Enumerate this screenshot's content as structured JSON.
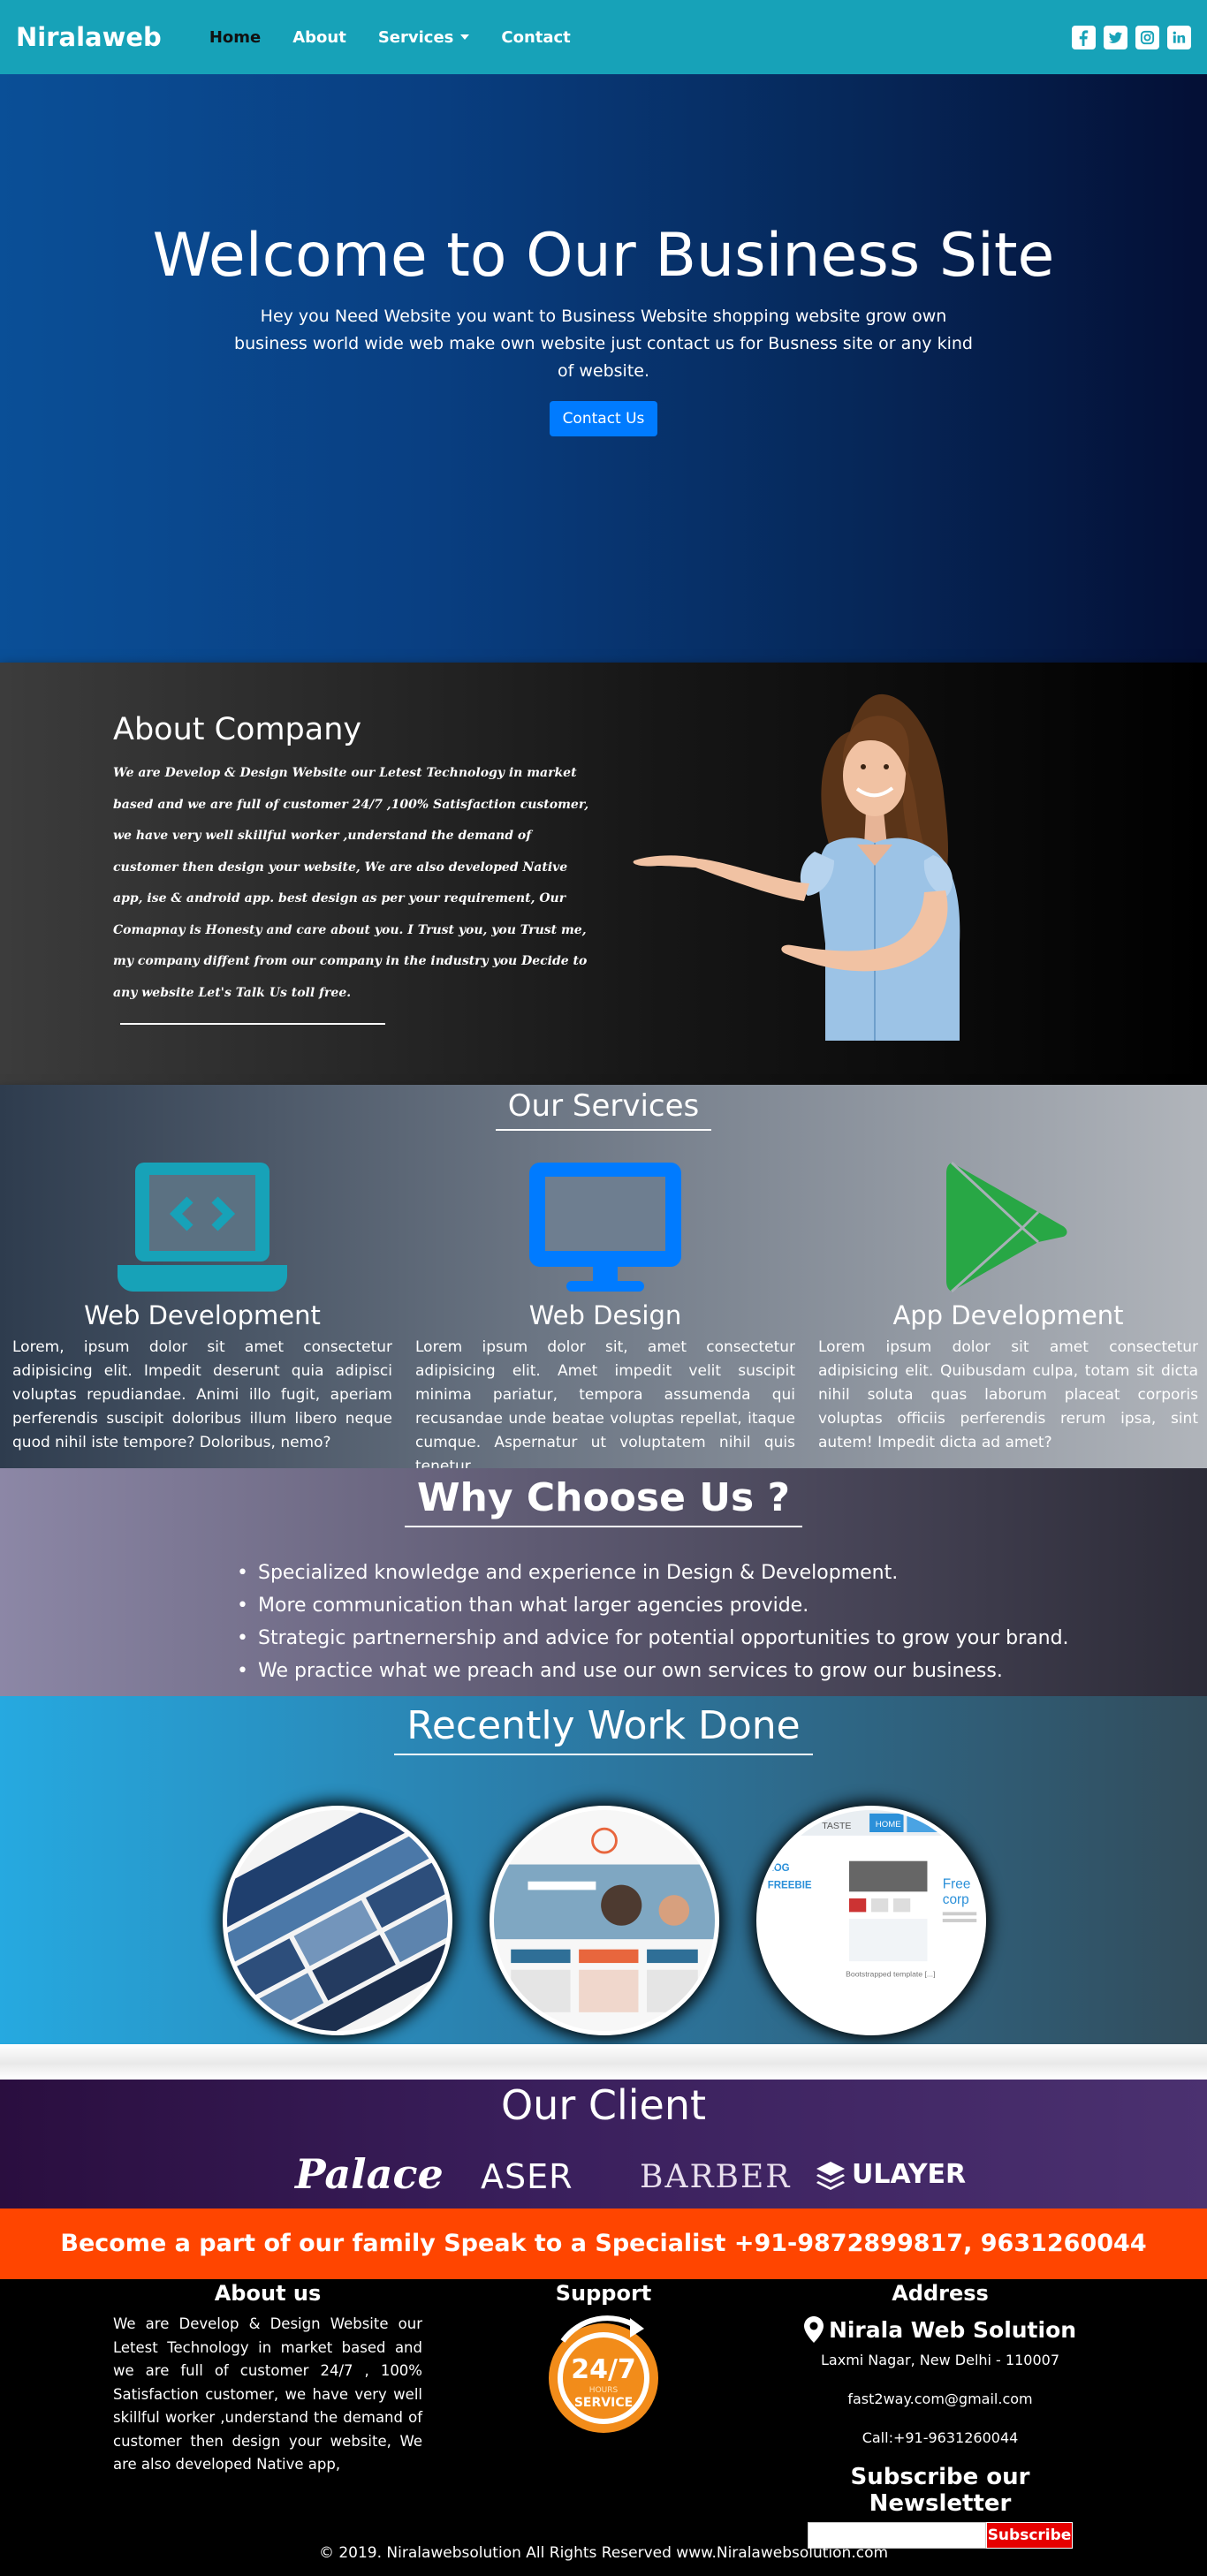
{
  "navbar": {
    "brand": "Niralaweb",
    "links": [
      "Home",
      "About",
      "Services",
      "Contact"
    ],
    "social_icons": [
      "facebook-icon",
      "twitter-icon",
      "instagram-icon",
      "linkedin-icon"
    ]
  },
  "hero": {
    "title": "Welcome to Our Business Site",
    "text": "Hey you Need Website you want to Business Website shopping website grow own business world wide web make own website just contact us for Busness site or any kind of website.",
    "button": "Contact Us"
  },
  "about": {
    "title": "About Company",
    "text": "We are Develop & Design Website our Letest Technology in market based and we are full of customer 24/7 ,100% Satisfaction customer, we have very well skillful worker ,understand the demand of customer then design your website, We are also developed Native app, ise & android app. best design as per your requirement, Our Comapnay is Honesty and care about you. I Trust you, you Trust me, my company diffent from our company in the industry you Decide to any website Let's Talk Us toll free."
  },
  "services": {
    "title": "Our Services",
    "items": [
      {
        "title": "Web Development",
        "icon": "laptop-code-icon",
        "text": "Lorem, ipsum dolor sit amet consectetur adipisicing elit. Impedit deserunt quia adipisci voluptas repudiandae. Animi illo fugit, aperiam perferendis suscipit doloribus illum libero neque quod nihil iste tempore? Doloribus, nemo?"
      },
      {
        "title": "Web Design",
        "icon": "desktop-icon",
        "text": "Lorem ipsum dolor sit, amet consectetur adipisicing elit. Amet impedit velit suscipit minima pariatur, tempora assumenda qui recusandae unde beatae voluptas repellat, itaque cumque. Aspernatur ut voluptatem nihil quis tenetur."
      },
      {
        "title": "App Development",
        "icon": "google-play-icon",
        "text": "Lorem ipsum dolor sit amet consectetur adipisicing elit. Quibusdam culpa, totam sit dicta nihil soluta quas laborum placeat corporis voluptas officiis perferendis rerum ipsa, sint autem! Impedit dicta ad amet?"
      }
    ],
    "colors": {
      "web_dev": "#17a2b8",
      "web_design": "#007bff",
      "app_dev": "#28a745"
    }
  },
  "why": {
    "title": "Why Choose Us ?",
    "items": [
      "Specialized knowledge and experience in Design & Development.",
      "More communication than what larger agencies provide.",
      "Strategic partnernership and advice for potential opportunities to grow your brand.",
      "We practice what we preach and use our own services to grow our business."
    ]
  },
  "recent": {
    "title": "Recently Work Done",
    "thumb3": {
      "tab": "HOME",
      "brand": "TASTE",
      "left_text": "LOG FREEBIE",
      "side_text": "Free corp",
      "caption": "Bootstrapped template [...]"
    }
  },
  "clients": {
    "title": "Our Client",
    "logos": [
      "Palace",
      "ASER",
      "BARBER",
      "ULAYER"
    ]
  },
  "cta": {
    "text": "Become a part of our family Speak to a Specialist +91-9872899817, 9631260044"
  },
  "footer": {
    "about_title": "About us",
    "about_text": "We are Develop & Design Website our Letest Technology in market based and we are full of customer 24/7 , 100% Satisfaction customer, we have very well skillful worker ,understand the demand of customer then design your website, We are also developed Native app,",
    "support_title": "Support",
    "support_badge": {
      "top": "24/7",
      "middle": "HOURS",
      "bottom": "SERVICE"
    },
    "address_title": "Address",
    "company": "Nirala Web Solution",
    "address": "Laxmi Nagar, New Delhi - 110007",
    "email": "fast2way.com@gmail.com",
    "phone": "Call:+91-9631260044",
    "newsletter_title": "Subscribe our Newsletter",
    "subscribe_button": "Subscribe",
    "copyright": "© 2019. Niralawebsolution All Rights Reserved www.Niralawebsolution.com"
  }
}
